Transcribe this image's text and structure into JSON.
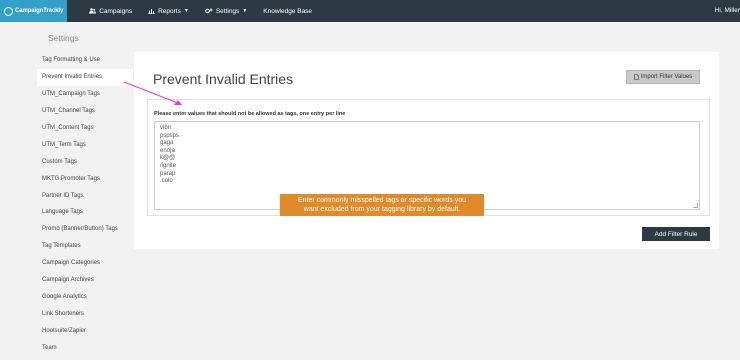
{
  "nav": {
    "logo": "CampaignTrackly",
    "items": [
      {
        "label": "Campaigns",
        "icon": "users-icon"
      },
      {
        "label": "Reports",
        "icon": "bar-chart-icon"
      },
      {
        "label": "Settings",
        "icon": "gear-icon"
      },
      {
        "label": "Knowledge Base"
      }
    ],
    "greeting": "Hi, Miller"
  },
  "sidebar": {
    "title": "Settings",
    "items": [
      "Tag Formatting & Use",
      "Prevent Invalid Entries",
      "UTM_Campaign Tags",
      "UTM_Channel Tags",
      "UTM_Content Tags",
      "UTM_Term Tags",
      "Custom Tags",
      "MKTG Promoter Tags",
      "Partner ID Tags",
      "Language Tags",
      "Promo (Banner/Button) Tags",
      "Tag Templates",
      "Campaign Categories",
      "Campaign Archives",
      "Google Analytics",
      "Link Shorteners",
      "Hootsuite/Zapier",
      "Team"
    ],
    "active_index": 1
  },
  "main": {
    "title": "Prevent Invalid Entries",
    "import_button": "Import Filter Values",
    "field_label": "Please enter values that should not be allowed as tags, one entry per line",
    "entries": [
      "vibri",
      "pspsps",
      "gaga",
      "eno|a",
      "k@@",
      "/ignite",
      "parap",
      ".colo"
    ],
    "add_button": "Add Filter Rule"
  },
  "annotation": {
    "line1": "Enter  commonly misspelled tags or specific words you",
    "line2": "want excluded from your tagging library by default."
  },
  "colors": {
    "nav_bg": "#2c3a44",
    "logo_bg": "#34a0c9",
    "callout": "#e08a2b",
    "arrow": "#e83ad6"
  }
}
